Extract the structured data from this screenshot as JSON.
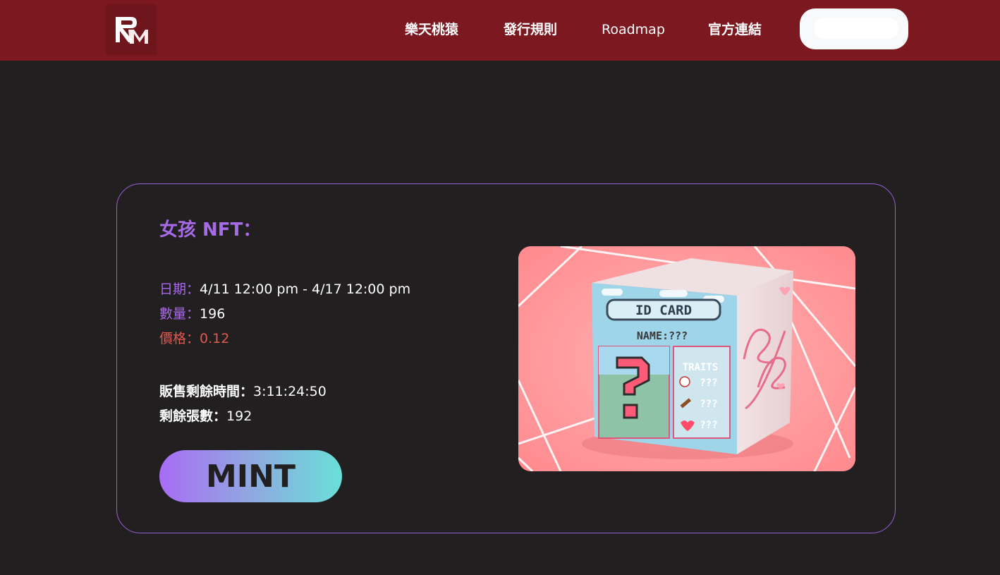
{
  "nav": {
    "links": [
      "樂天桃猿",
      "發行規則",
      "Roadmap",
      "官方連結"
    ],
    "wallet_label": ""
  },
  "card": {
    "title": "女孩 NFT：",
    "date_label": "日期：",
    "date_value": "4/11 12:00 pm - 4/17 12:00 pm",
    "quantity_label": "數量：",
    "quantity_value": "196",
    "price_label": "價格：",
    "price_value": "0.12",
    "remaining_time_label": "販售剩餘時間：",
    "remaining_time_value": "3:11:24:50",
    "remaining_count_label": "剩餘張數：",
    "remaining_count_value": "192",
    "mint_label": "MINT"
  },
  "image": {
    "id_card": "ID CARD",
    "name": "NAME:???",
    "traits": "TRAITS",
    "trait_values": [
      "???",
      "???",
      "???"
    ]
  },
  "colors": {
    "header": "#7c1820",
    "background": "#221f20",
    "accent_purple": "#a76ae8",
    "accent_red": "#e0584f"
  }
}
